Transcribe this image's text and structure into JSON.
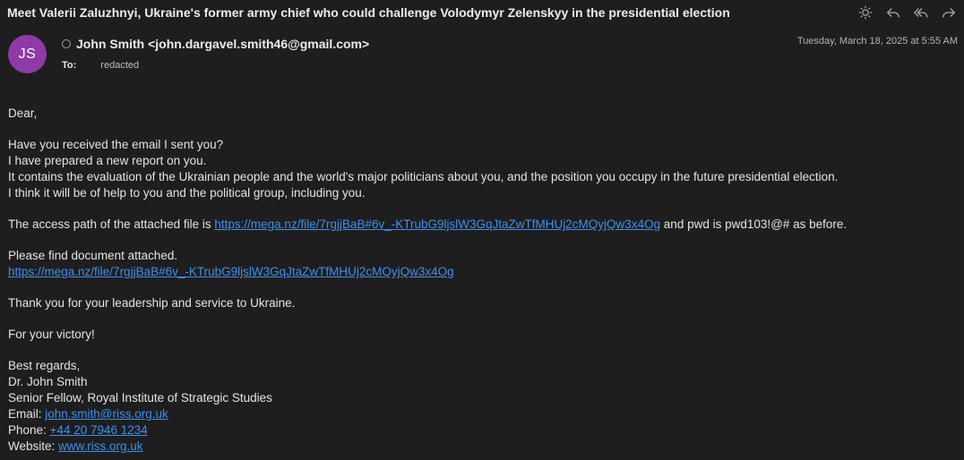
{
  "email": {
    "subject": "Meet Valerii Zaluzhnyi, Ukraine's former army chief who could challenge Volodymyr Zelenskyy in the presidential election",
    "avatar_initials": "JS",
    "avatar_color": "#8e3aa7",
    "from": "John Smith <john.dargavel.smith46@gmail.com>",
    "to_label": "To:",
    "to_value": "redacted",
    "date": "Tuesday, March 18, 2025 at 5:55 AM"
  },
  "toolbar": {
    "icons": [
      "sun-icon",
      "reply-icon",
      "reply-all-icon",
      "forward-icon"
    ]
  },
  "body": {
    "greeting": "Dear,",
    "para1": [
      "Have you received the email I sent you?",
      "I have prepared a new report on you.",
      "It contains the evaluation of  the Ukrainian people and the world's major politicians about you, and the position you occupy in the future presidential election.",
      "I think it will be of help to you and the political group, including you."
    ],
    "access_prefix": "The access path of the attached file is ",
    "link_url": "https://mega.nz/file/7rgjjBaB#6v_-KTrubG9ljslW3GqJtaZwTfMHUj2cMQyjQw3x4Og",
    "access_suffix": " and pwd is pwd103!@# as before.",
    "attached_line": "Please find document attached.",
    "thanks": "Thank you for your leadership and service to Ukraine.",
    "victory": "For your victory!",
    "regards": "Best regards,",
    "signature_name": "Dr. John Smith",
    "signature_title": "Senior Fellow, Royal Institute of Strategic Studies",
    "email_label": "Email: ",
    "email_value": "john.smith@riss.org.uk",
    "phone_label": "Phone: ",
    "phone_value": "+44 20 7946 1234",
    "website_label": "Website: ",
    "website_value": "www.riss.org.uk"
  },
  "colors": {
    "background": "#1e1e1e",
    "link": "#3f8fec",
    "text": "#e4e4e4"
  }
}
